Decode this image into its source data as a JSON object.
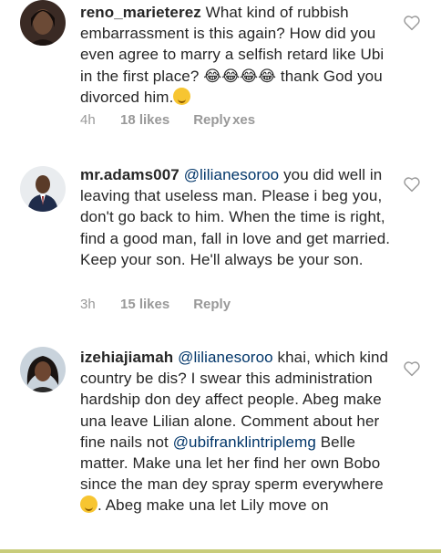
{
  "comments": [
    {
      "username": "reno_marieterez",
      "text": "What kind of rubbish embarrassment is this again? How did you even agree to marry a selfish retard like Ubi in the first place? 😂😂😂😂 thank God you divorced him.",
      "emoji": "thinking-face-emoji",
      "time": "4h",
      "likes": "18 likes",
      "reply": "Reply",
      "reply_suffix": "xes"
    },
    {
      "username": "mr.adams007",
      "mention": "@lilianesoroo",
      "text": " you did well in leaving that useless man. Please i beg you, don't go back to him. When the time is right, find a good man, fall in love and get married. Keep your son. He'll always be your son.",
      "time": "3h",
      "likes": "15 likes",
      "reply": "Reply"
    },
    {
      "username": "izehiajiamah",
      "mention": "@lilianesoroo",
      "text_a": " khai, which kind country be dis? I swear this administration hardship don dey affect people. Abeg make una leave Lilian alone. Comment about her fine nails not ",
      "mention_b": "@ubifranklintriplemg",
      "text_b": " Belle matter. Make una let her find her own Bobo since the man dey spray sperm everywhere",
      "emoji": "laughing-face-emoji",
      "text_c": ". Abeg make una let Lily move on"
    }
  ],
  "colors": {
    "text": "#262626",
    "meta": "#999999",
    "mention": "#003569",
    "heart_stroke": "#999999"
  },
  "icons": {
    "like": "heart-outline-icon"
  }
}
